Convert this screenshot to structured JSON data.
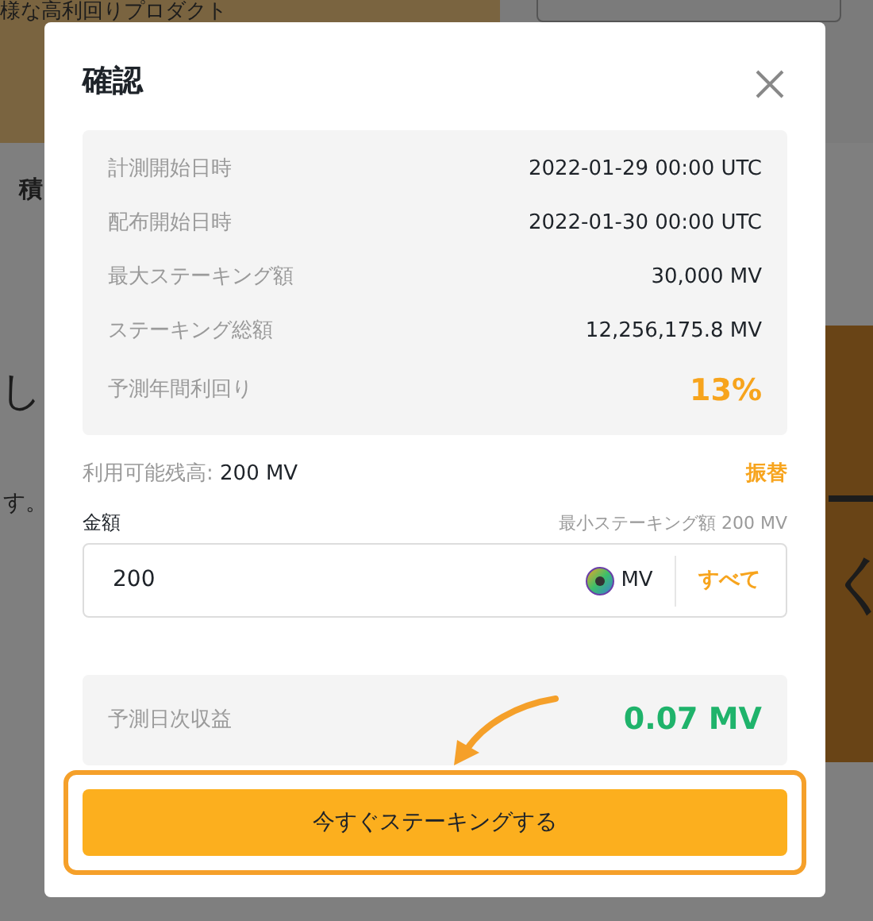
{
  "background": {
    "texts": [
      {
        "text": "様な高利回りプロダクト",
        "kind": "tagline"
      },
      {
        "text": "積",
        "kind": "tab"
      },
      {
        "text": "し",
        "kind": "heading"
      },
      {
        "text": "す。",
        "kind": "body"
      },
      {
        "text": "く",
        "kind": "side-question"
      }
    ]
  },
  "dialog": {
    "title": "確認",
    "details": [
      {
        "label": "計測開始日時",
        "value": "2022-01-29 00:00 UTC",
        "kind": "plain"
      },
      {
        "label": "配布開始日時",
        "value": "2022-01-30 00:00 UTC",
        "kind": "plain"
      },
      {
        "label": "最大ステーキング額",
        "value": "30,000 MV",
        "kind": "plain"
      },
      {
        "label": "ステーキング総額",
        "value": "12,256,175.8 MV",
        "kind": "plain"
      },
      {
        "label": "予測年間利回り",
        "value": "13%",
        "kind": "highlight"
      }
    ],
    "balance": {
      "label": "利用可能残高:",
      "value": "200 MV"
    },
    "transfer_link": "振替",
    "amount": {
      "label": "金額",
      "hint": "最小ステーキング額 200 MV",
      "value": "200",
      "currency": "MV",
      "max_button": "すべて"
    },
    "estimate": {
      "label": "予測日次収益",
      "value": "0.07 MV"
    },
    "submit": {
      "label": "今すぐステーキングする",
      "outlined": true
    }
  }
}
